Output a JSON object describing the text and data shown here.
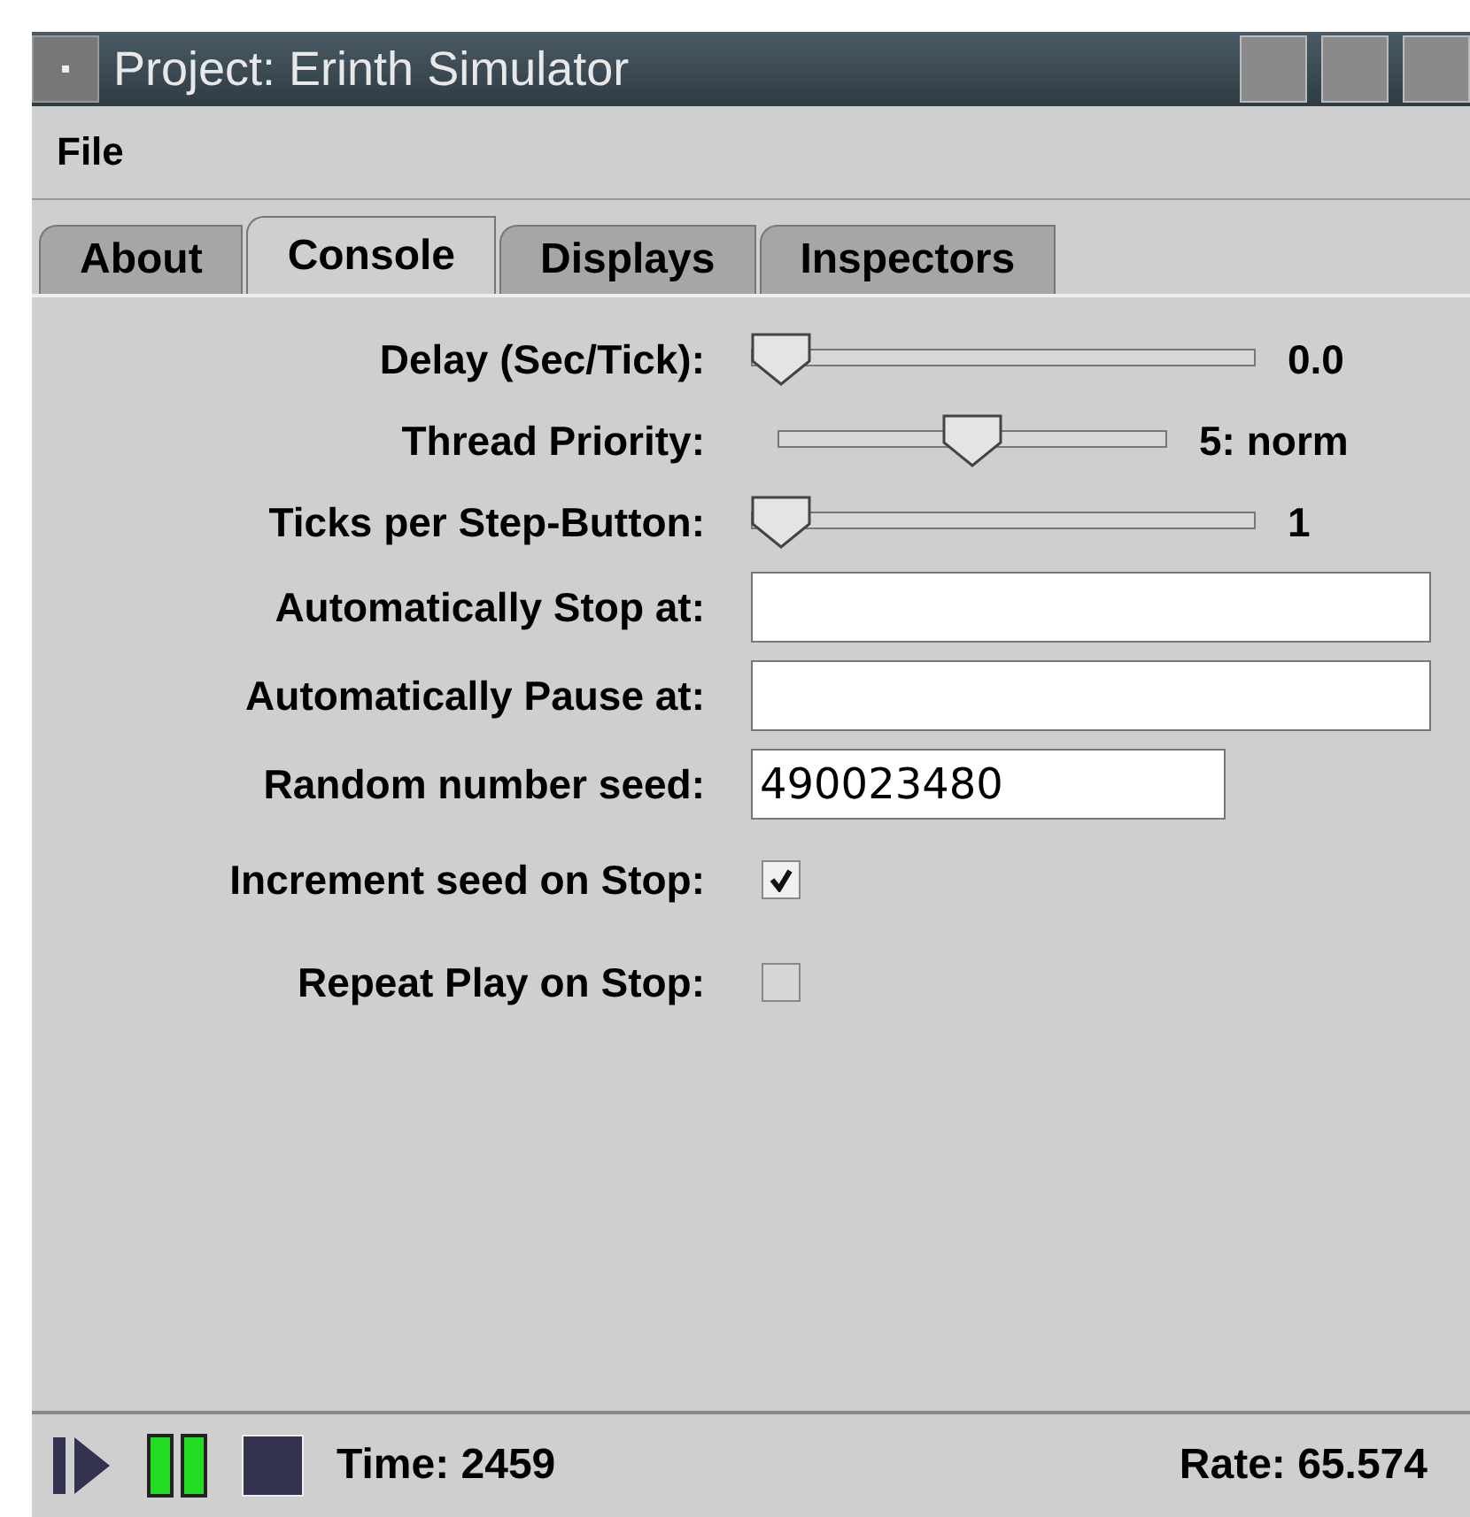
{
  "window": {
    "title": "Project: Erinth Simulator"
  },
  "menu": [
    "File"
  ],
  "tabs": [
    {
      "label": "About",
      "selected": false
    },
    {
      "label": "Console",
      "selected": true
    },
    {
      "label": "Displays",
      "selected": false
    },
    {
      "label": "Inspectors",
      "selected": false
    }
  ],
  "rows": [
    {
      "kind": "slider",
      "label": "Delay (Sec/Tick):",
      "level": 0,
      "reading": "0.0",
      "wide": true
    },
    {
      "kind": "slider",
      "label": "Thread Priority:",
      "level": 0.5,
      "reading": "5: norm",
      "wide": false
    },
    {
      "kind": "slider",
      "label": "Ticks per Step-Button:",
      "level": 0,
      "reading": "1",
      "wide": true
    },
    {
      "kind": "field",
      "label": "Automatically Stop at:",
      "value": "",
      "wide": true
    },
    {
      "kind": "field",
      "label": "Automatically Pause at:",
      "value": "",
      "wide": true
    },
    {
      "kind": "field",
      "label": "Random number seed:",
      "value": "490023480",
      "wide": false
    },
    {
      "kind": "checkbox",
      "label": "Increment seed on Stop:",
      "checked": true
    },
    {
      "kind": "checkbox",
      "label": "Repeat Play on Stop:",
      "checked": false
    }
  ],
  "status_bar": {
    "buttons": [
      {
        "kind": "play",
        "active": false
      },
      {
        "kind": "pause",
        "active": true
      },
      {
        "kind": "stop",
        "active": false
      }
    ],
    "time": "Time: 2459",
    "rate": "Rate: 65.574"
  }
}
